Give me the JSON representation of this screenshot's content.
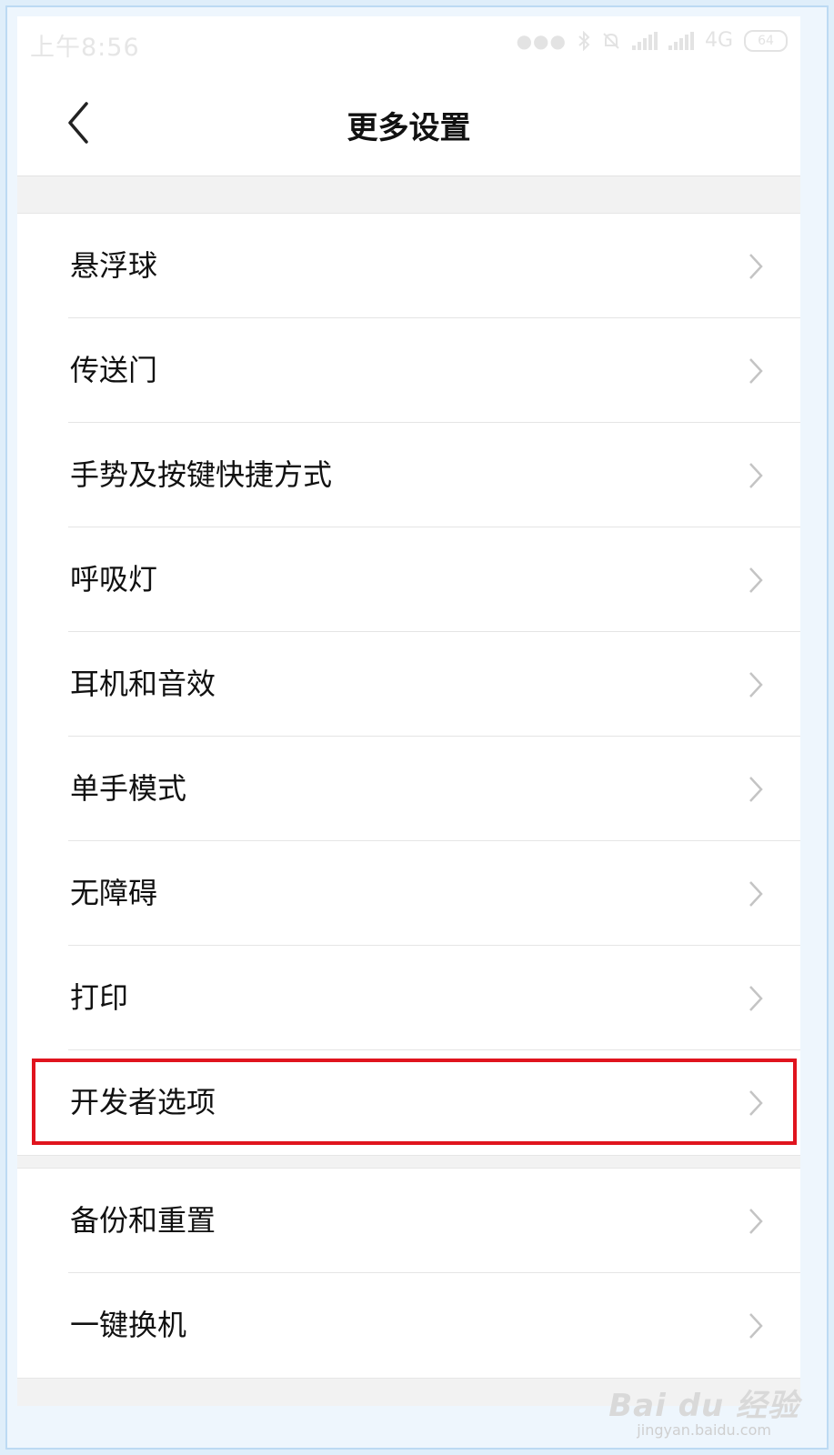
{
  "status_bar": {
    "time": "上午8:56",
    "network": "4G",
    "battery": "64",
    "icons": [
      "dots-icon",
      "bluetooth-icon",
      "mute-icon",
      "signal-icon",
      "signal-icon",
      "battery-icon"
    ]
  },
  "header": {
    "back_icon": "chevron-left-icon",
    "title": "更多设置"
  },
  "sections": [
    {
      "items": [
        {
          "label": "悬浮球"
        },
        {
          "label": "传送门"
        },
        {
          "label": "手势及按键快捷方式"
        },
        {
          "label": "呼吸灯"
        },
        {
          "label": "耳机和音效"
        },
        {
          "label": "单手模式"
        },
        {
          "label": "无障碍"
        },
        {
          "label": "打印"
        },
        {
          "label": "开发者选项",
          "highlighted": true
        }
      ]
    },
    {
      "items": [
        {
          "label": "备份和重置"
        },
        {
          "label": "一键换机"
        }
      ]
    }
  ],
  "annotation": {
    "highlight_color": "#e0141e"
  },
  "watermark": {
    "brand": "Bai du 经验",
    "url": "jingyan.baidu.com"
  },
  "colors": {
    "frame_border": "#bcdaf3",
    "page_background": "#f2f2f2",
    "item_text": "#111111",
    "chevron": "#c4c4c4"
  }
}
